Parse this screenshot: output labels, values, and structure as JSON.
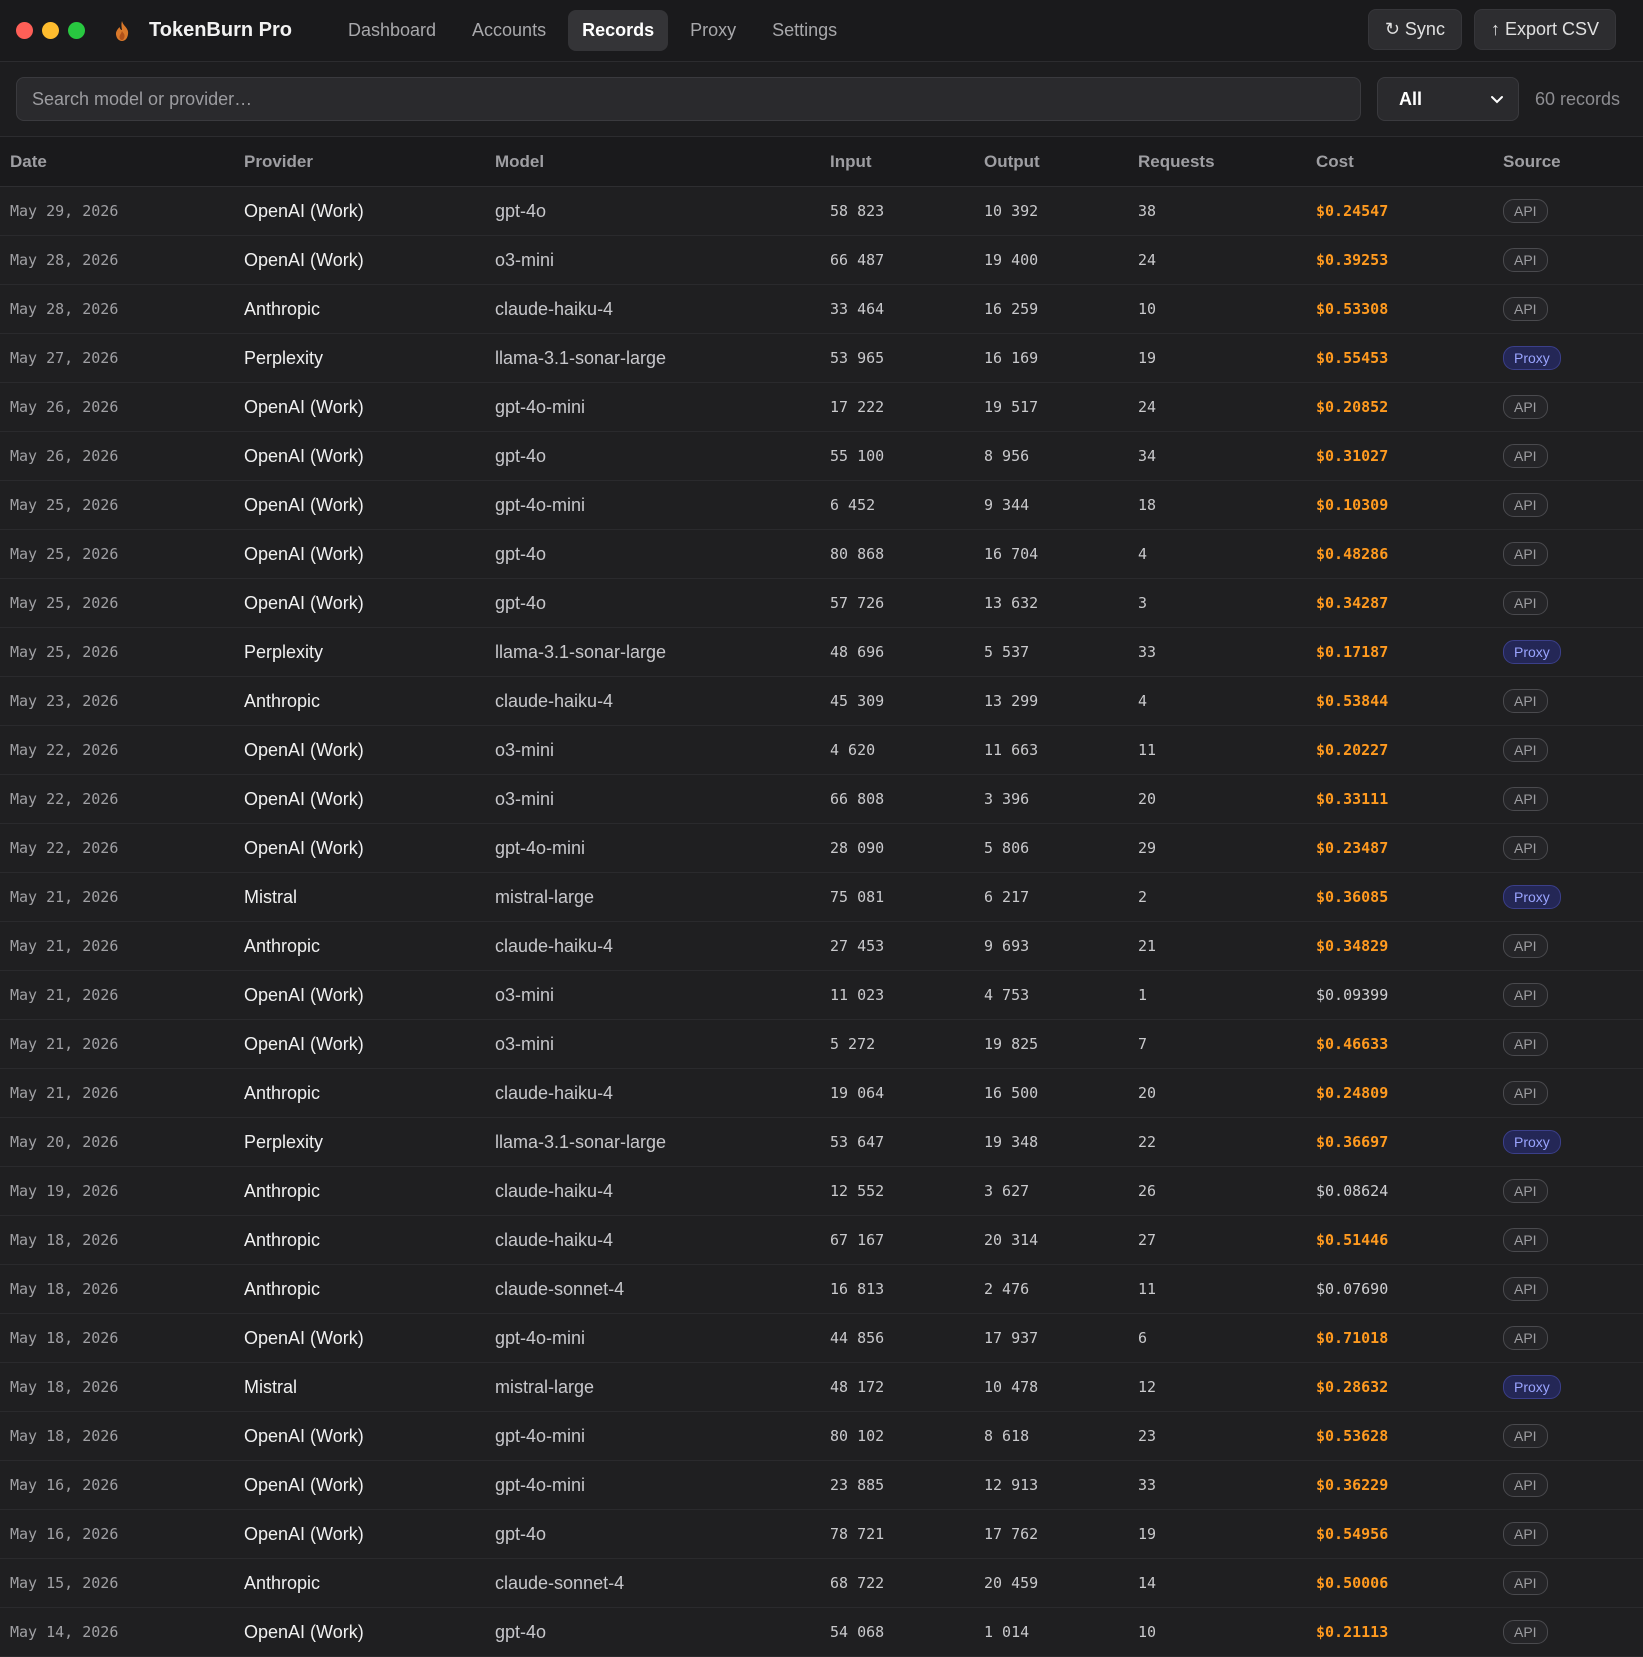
{
  "app": {
    "title": "TokenBurn Pro",
    "nav": [
      "Dashboard",
      "Accounts",
      "Records",
      "Proxy",
      "Settings"
    ],
    "active_nav": "Records",
    "sync_label": "↻ Sync",
    "export_label": "↑ Export CSV"
  },
  "filters": {
    "search_placeholder": "Search model or provider…",
    "source_filter": "All",
    "record_count": "60 records"
  },
  "colors": {
    "cost_high": "#ff9a1f",
    "proxy_badge": "#9aa4ff",
    "background": "#1f1f21"
  },
  "table": {
    "headers": [
      "Date",
      "Provider",
      "Model",
      "Input",
      "Output",
      "Requests",
      "Cost",
      "Source"
    ],
    "rows": [
      [
        "May 29, 2026",
        "OpenAI (Work)",
        "gpt-4o",
        "58 823",
        "10 392",
        "38",
        "$0.24547",
        "API"
      ],
      [
        "May 28, 2026",
        "OpenAI (Work)",
        "o3-mini",
        "66 487",
        "19 400",
        "24",
        "$0.39253",
        "API"
      ],
      [
        "May 28, 2026",
        "Anthropic",
        "claude-haiku-4",
        "33 464",
        "16 259",
        "10",
        "$0.53308",
        "API"
      ],
      [
        "May 27, 2026",
        "Perplexity",
        "llama-3.1-sonar-large",
        "53 965",
        "16 169",
        "19",
        "$0.55453",
        "Proxy"
      ],
      [
        "May 26, 2026",
        "OpenAI (Work)",
        "gpt-4o-mini",
        "17 222",
        "19 517",
        "24",
        "$0.20852",
        "API"
      ],
      [
        "May 26, 2026",
        "OpenAI (Work)",
        "gpt-4o",
        "55 100",
        "8 956",
        "34",
        "$0.31027",
        "API"
      ],
      [
        "May 25, 2026",
        "OpenAI (Work)",
        "gpt-4o-mini",
        "6 452",
        "9 344",
        "18",
        "$0.10309",
        "API"
      ],
      [
        "May 25, 2026",
        "OpenAI (Work)",
        "gpt-4o",
        "80 868",
        "16 704",
        "4",
        "$0.48286",
        "API"
      ],
      [
        "May 25, 2026",
        "OpenAI (Work)",
        "gpt-4o",
        "57 726",
        "13 632",
        "3",
        "$0.34287",
        "API"
      ],
      [
        "May 25, 2026",
        "Perplexity",
        "llama-3.1-sonar-large",
        "48 696",
        "5 537",
        "33",
        "$0.17187",
        "Proxy"
      ],
      [
        "May 23, 2026",
        "Anthropic",
        "claude-haiku-4",
        "45 309",
        "13 299",
        "4",
        "$0.53844",
        "API"
      ],
      [
        "May 22, 2026",
        "OpenAI (Work)",
        "o3-mini",
        "4 620",
        "11 663",
        "11",
        "$0.20227",
        "API"
      ],
      [
        "May 22, 2026",
        "OpenAI (Work)",
        "o3-mini",
        "66 808",
        "3 396",
        "20",
        "$0.33111",
        "API"
      ],
      [
        "May 22, 2026",
        "OpenAI (Work)",
        "gpt-4o-mini",
        "28 090",
        "5 806",
        "29",
        "$0.23487",
        "API"
      ],
      [
        "May 21, 2026",
        "Mistral",
        "mistral-large",
        "75 081",
        "6 217",
        "2",
        "$0.36085",
        "Proxy"
      ],
      [
        "May 21, 2026",
        "Anthropic",
        "claude-haiku-4",
        "27 453",
        "9 693",
        "21",
        "$0.34829",
        "API"
      ],
      [
        "May 21, 2026",
        "OpenAI (Work)",
        "o3-mini",
        "11 023",
        "4 753",
        "1",
        "$0.09399",
        "API"
      ],
      [
        "May 21, 2026",
        "OpenAI (Work)",
        "o3-mini",
        "5 272",
        "19 825",
        "7",
        "$0.46633",
        "API"
      ],
      [
        "May 21, 2026",
        "Anthropic",
        "claude-haiku-4",
        "19 064",
        "16 500",
        "20",
        "$0.24809",
        "API"
      ],
      [
        "May 20, 2026",
        "Perplexity",
        "llama-3.1-sonar-large",
        "53 647",
        "19 348",
        "22",
        "$0.36697",
        "Proxy"
      ],
      [
        "May 19, 2026",
        "Anthropic",
        "claude-haiku-4",
        "12 552",
        "3 627",
        "26",
        "$0.08624",
        "API"
      ],
      [
        "May 18, 2026",
        "Anthropic",
        "claude-haiku-4",
        "67 167",
        "20 314",
        "27",
        "$0.51446",
        "API"
      ],
      [
        "May 18, 2026",
        "Anthropic",
        "claude-sonnet-4",
        "16 813",
        "2 476",
        "11",
        "$0.07690",
        "API"
      ],
      [
        "May 18, 2026",
        "OpenAI (Work)",
        "gpt-4o-mini",
        "44 856",
        "17 937",
        "6",
        "$0.71018",
        "API"
      ],
      [
        "May 18, 2026",
        "Mistral",
        "mistral-large",
        "48 172",
        "10 478",
        "12",
        "$0.28632",
        "Proxy"
      ],
      [
        "May 18, 2026",
        "OpenAI (Work)",
        "gpt-4o-mini",
        "80 102",
        "8 618",
        "23",
        "$0.53628",
        "API"
      ],
      [
        "May 16, 2026",
        "OpenAI (Work)",
        "gpt-4o-mini",
        "23 885",
        "12 913",
        "33",
        "$0.36229",
        "API"
      ],
      [
        "May 16, 2026",
        "OpenAI (Work)",
        "gpt-4o",
        "78 721",
        "17 762",
        "19",
        "$0.54956",
        "API"
      ],
      [
        "May 15, 2026",
        "Anthropic",
        "claude-sonnet-4",
        "68 722",
        "20 459",
        "14",
        "$0.50006",
        "API"
      ],
      [
        "May 14, 2026",
        "OpenAI (Work)",
        "gpt-4o",
        "54 068",
        "1 014",
        "10",
        "$0.21113",
        "API"
      ]
    ]
  }
}
